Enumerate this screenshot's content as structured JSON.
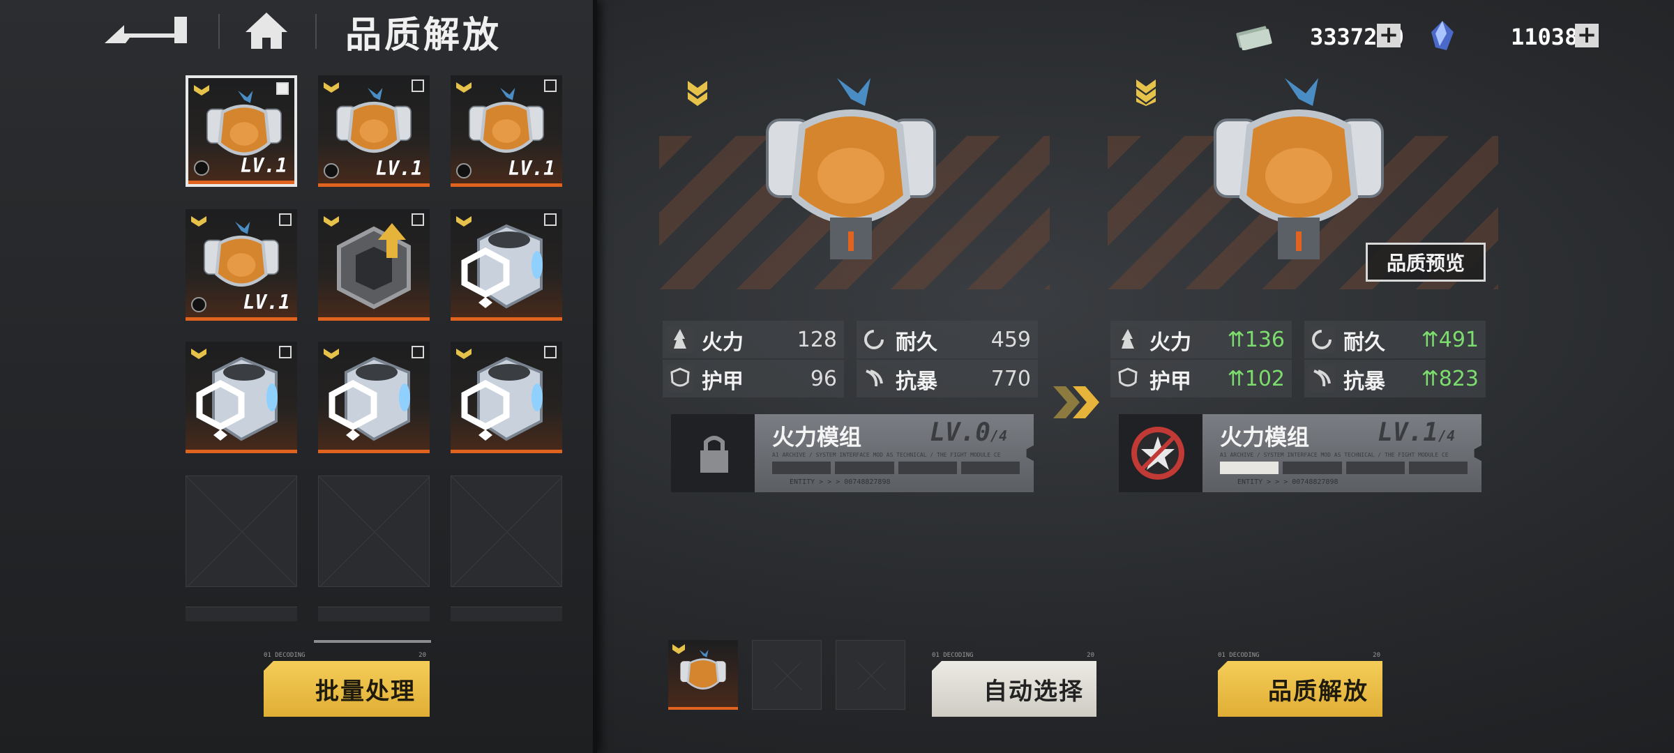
{
  "header": {
    "title": "品质解放",
    "back_icon": "back-arrow-icon",
    "home_icon": "home-icon"
  },
  "currency": [
    {
      "name": "credits",
      "icon": "cash-icon",
      "value": "3337210"
    },
    {
      "name": "crystal",
      "icon": "crystal-icon",
      "value": "110383"
    }
  ],
  "inventory": {
    "items": [
      {
        "type": "mech",
        "level": "LV.1",
        "selected": true,
        "checked": true
      },
      {
        "type": "mech",
        "level": "LV.1",
        "selected": false,
        "checked": false
      },
      {
        "type": "mech",
        "level": "LV.1",
        "selected": false,
        "checked": false
      },
      {
        "type": "mech",
        "level": "LV.1",
        "selected": false,
        "checked": false
      },
      {
        "type": "upgrade-part",
        "level": "",
        "selected": false,
        "checked": false
      },
      {
        "type": "cube-part",
        "level": "",
        "selected": false,
        "checked": false
      },
      {
        "type": "cube-part",
        "level": "",
        "selected": false,
        "checked": false
      },
      {
        "type": "cube-part",
        "level": "",
        "selected": false,
        "checked": false
      },
      {
        "type": "cube-part",
        "level": "",
        "selected": false,
        "checked": false
      }
    ],
    "batch_button": "批量处理"
  },
  "current": {
    "stats": [
      {
        "name": "火力",
        "icon": "firepower-icon",
        "value": "128"
      },
      {
        "name": "耐久",
        "icon": "durability-icon",
        "value": "459"
      },
      {
        "name": "护甲",
        "icon": "armor-icon",
        "value": "96"
      },
      {
        "name": "抗暴",
        "icon": "crit-resist-icon",
        "value": "770"
      }
    ],
    "module": {
      "name": "火力模组",
      "level": "LV.0",
      "max": "/4",
      "progress": 0,
      "locked": true
    }
  },
  "preview": {
    "preview_button": "品质预览",
    "stats": [
      {
        "name": "火力",
        "icon": "firepower-icon",
        "value": "136"
      },
      {
        "name": "耐久",
        "icon": "durability-icon",
        "value": "491"
      },
      {
        "name": "护甲",
        "icon": "armor-icon",
        "value": "102"
      },
      {
        "name": "抗暴",
        "icon": "crit-resist-icon",
        "value": "823"
      }
    ],
    "module": {
      "name": "火力模组",
      "level": "LV.1",
      "max": "/4",
      "progress": 0.25,
      "locked": false
    }
  },
  "actions": {
    "auto_select": "自动选择",
    "quality_release": "品质解放"
  },
  "colors": {
    "accent_orange": "#e0641f",
    "button_yellow": "#e8b73f",
    "stat_up_green": "#7ddc6e",
    "rank_gold": "#e6c24b"
  }
}
